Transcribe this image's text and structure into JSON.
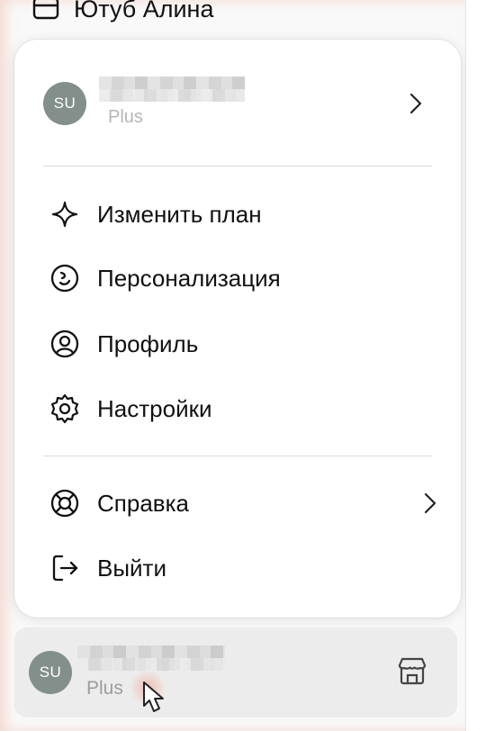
{
  "project": {
    "label": "Ютуб Алина",
    "icon": "folder-icon"
  },
  "menu": {
    "user": {
      "initials": "SU",
      "plan": "Plus",
      "icon": "chevron-right-icon"
    },
    "items": [
      {
        "label": "Изменить план",
        "icon": "sparkle-icon"
      },
      {
        "label": "Персонализация",
        "icon": "smile-icon"
      },
      {
        "label": "Профиль",
        "icon": "user-circle-icon"
      },
      {
        "label": "Настройки",
        "icon": "gear-icon"
      }
    ],
    "help": {
      "label": "Справка",
      "icon": "lifebuoy-icon"
    },
    "logout": {
      "label": "Выйти",
      "icon": "logout-icon"
    }
  },
  "account": {
    "initials": "SU",
    "plan": "Plus",
    "icon": "shop-icon"
  },
  "colors": {
    "avatar": "#838f8b",
    "menu_bg": "#ffffff",
    "card_bg": "#ececec",
    "accent_glow": "#f3c7b6"
  }
}
